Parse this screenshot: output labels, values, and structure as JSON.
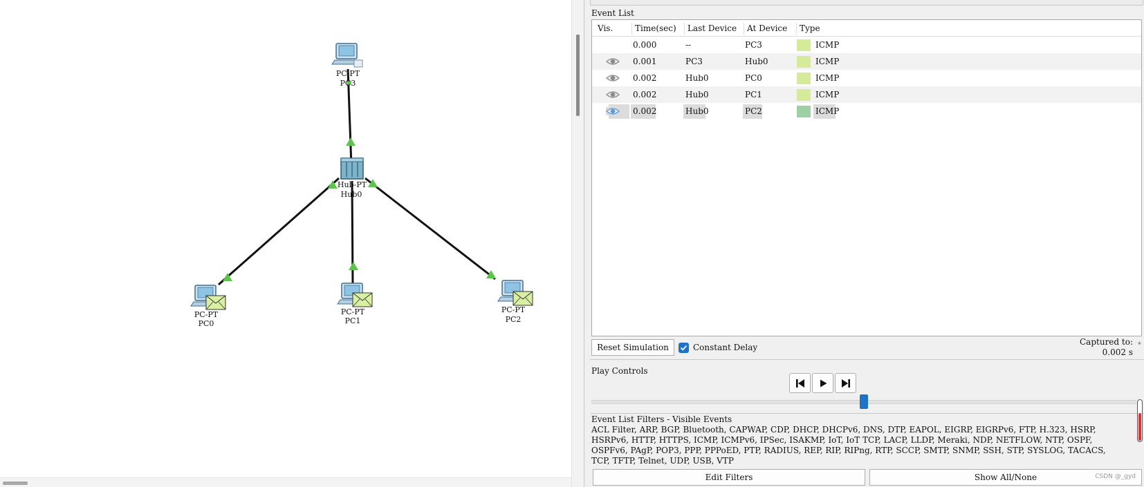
{
  "topology": {
    "devices": [
      {
        "id": "pc3",
        "model": "PC-PT",
        "name": "PC3",
        "icon": "pc-icon",
        "has_envelope": false
      },
      {
        "id": "hub0",
        "model": "Hub-PT",
        "name": "Hub0",
        "icon": "hub-icon",
        "has_envelope": false
      },
      {
        "id": "pc0",
        "model": "PC-PT",
        "name": "PC0",
        "icon": "pc-icon",
        "has_envelope": true
      },
      {
        "id": "pc1",
        "model": "PC-PT",
        "name": "PC1",
        "icon": "pc-icon",
        "has_envelope": true
      },
      {
        "id": "pc2",
        "model": "PC-PT",
        "name": "PC2",
        "icon": "pc-icon",
        "has_envelope": true
      }
    ],
    "links": [
      {
        "from": "hub0",
        "to": "pc3"
      },
      {
        "from": "hub0",
        "to": "pc0"
      },
      {
        "from": "hub0",
        "to": "pc1"
      },
      {
        "from": "hub0",
        "to": "pc2"
      }
    ],
    "link_color": "#111111",
    "port_indicator_color": "#5cc44a",
    "envelope_color": "#d9f0a3"
  },
  "event_list": {
    "title": "Event List",
    "columns": [
      "Vis.",
      "Time(sec)",
      "Last Device",
      "At Device",
      "Type"
    ],
    "rows": [
      {
        "vis": "",
        "time": "0.000",
        "last_device": "--",
        "at_device": "PC3",
        "type": "ICMP",
        "color": "#d5eb9a",
        "selected": false
      },
      {
        "vis": "eye-icon",
        "time": "0.001",
        "last_device": "PC3",
        "at_device": "Hub0",
        "type": "ICMP",
        "color": "#d5eb9a",
        "selected": false
      },
      {
        "vis": "eye-icon",
        "time": "0.002",
        "last_device": "Hub0",
        "at_device": "PC0",
        "type": "ICMP",
        "color": "#d5eb9a",
        "selected": false
      },
      {
        "vis": "eye-icon",
        "time": "0.002",
        "last_device": "Hub0",
        "at_device": "PC1",
        "type": "ICMP",
        "color": "#d5eb9a",
        "selected": false
      },
      {
        "vis": "eye-active-icon",
        "time": "0.002",
        "last_device": "Hub0",
        "at_device": "PC2",
        "type": "ICMP",
        "color": "#9fcfa5",
        "selected": true
      }
    ],
    "reset_label": "Reset Simulation",
    "constant_delay_label": "Constant Delay",
    "constant_delay_checked": true,
    "captured_label": "Captured to:",
    "captured_value": "0.002 s",
    "corner_mark": "*"
  },
  "play_controls": {
    "title": "Play Controls",
    "back_icon": "step-back-icon",
    "play_icon": "play-icon",
    "forward_icon": "step-forward-icon",
    "accent": "#1e73c8"
  },
  "filters": {
    "title": "Event List Filters - Visible Events",
    "list": "ACL Filter, ARP, BGP, Bluetooth, CAPWAP, CDP, DHCP, DHCPv6, DNS, DTP, EAPOL, EIGRP, EIGRPv6, FTP, H.323, HSRP,\nHSRPv6, HTTP, HTTPS, ICMP, ICMPv6, IPSec, ISAKMP, IoT, IoT TCP, LACP, LLDP, Meraki, NDP, NETFLOW, NTP, OSPF,\nOSPFv6, PAgP, POP3, PPP, PPPoED, PTP, RADIUS, REP, RIP, RIPng, RTP, SCCP, SMTP, SNMP, SSH, STP, SYSLOG, TACACS,\nTCP, TFTP, Telnet, UDP, USB, VTP",
    "edit_label": "Edit Filters",
    "show_all_label": "Show All/None"
  },
  "watermark": "CSDN @_gyd"
}
